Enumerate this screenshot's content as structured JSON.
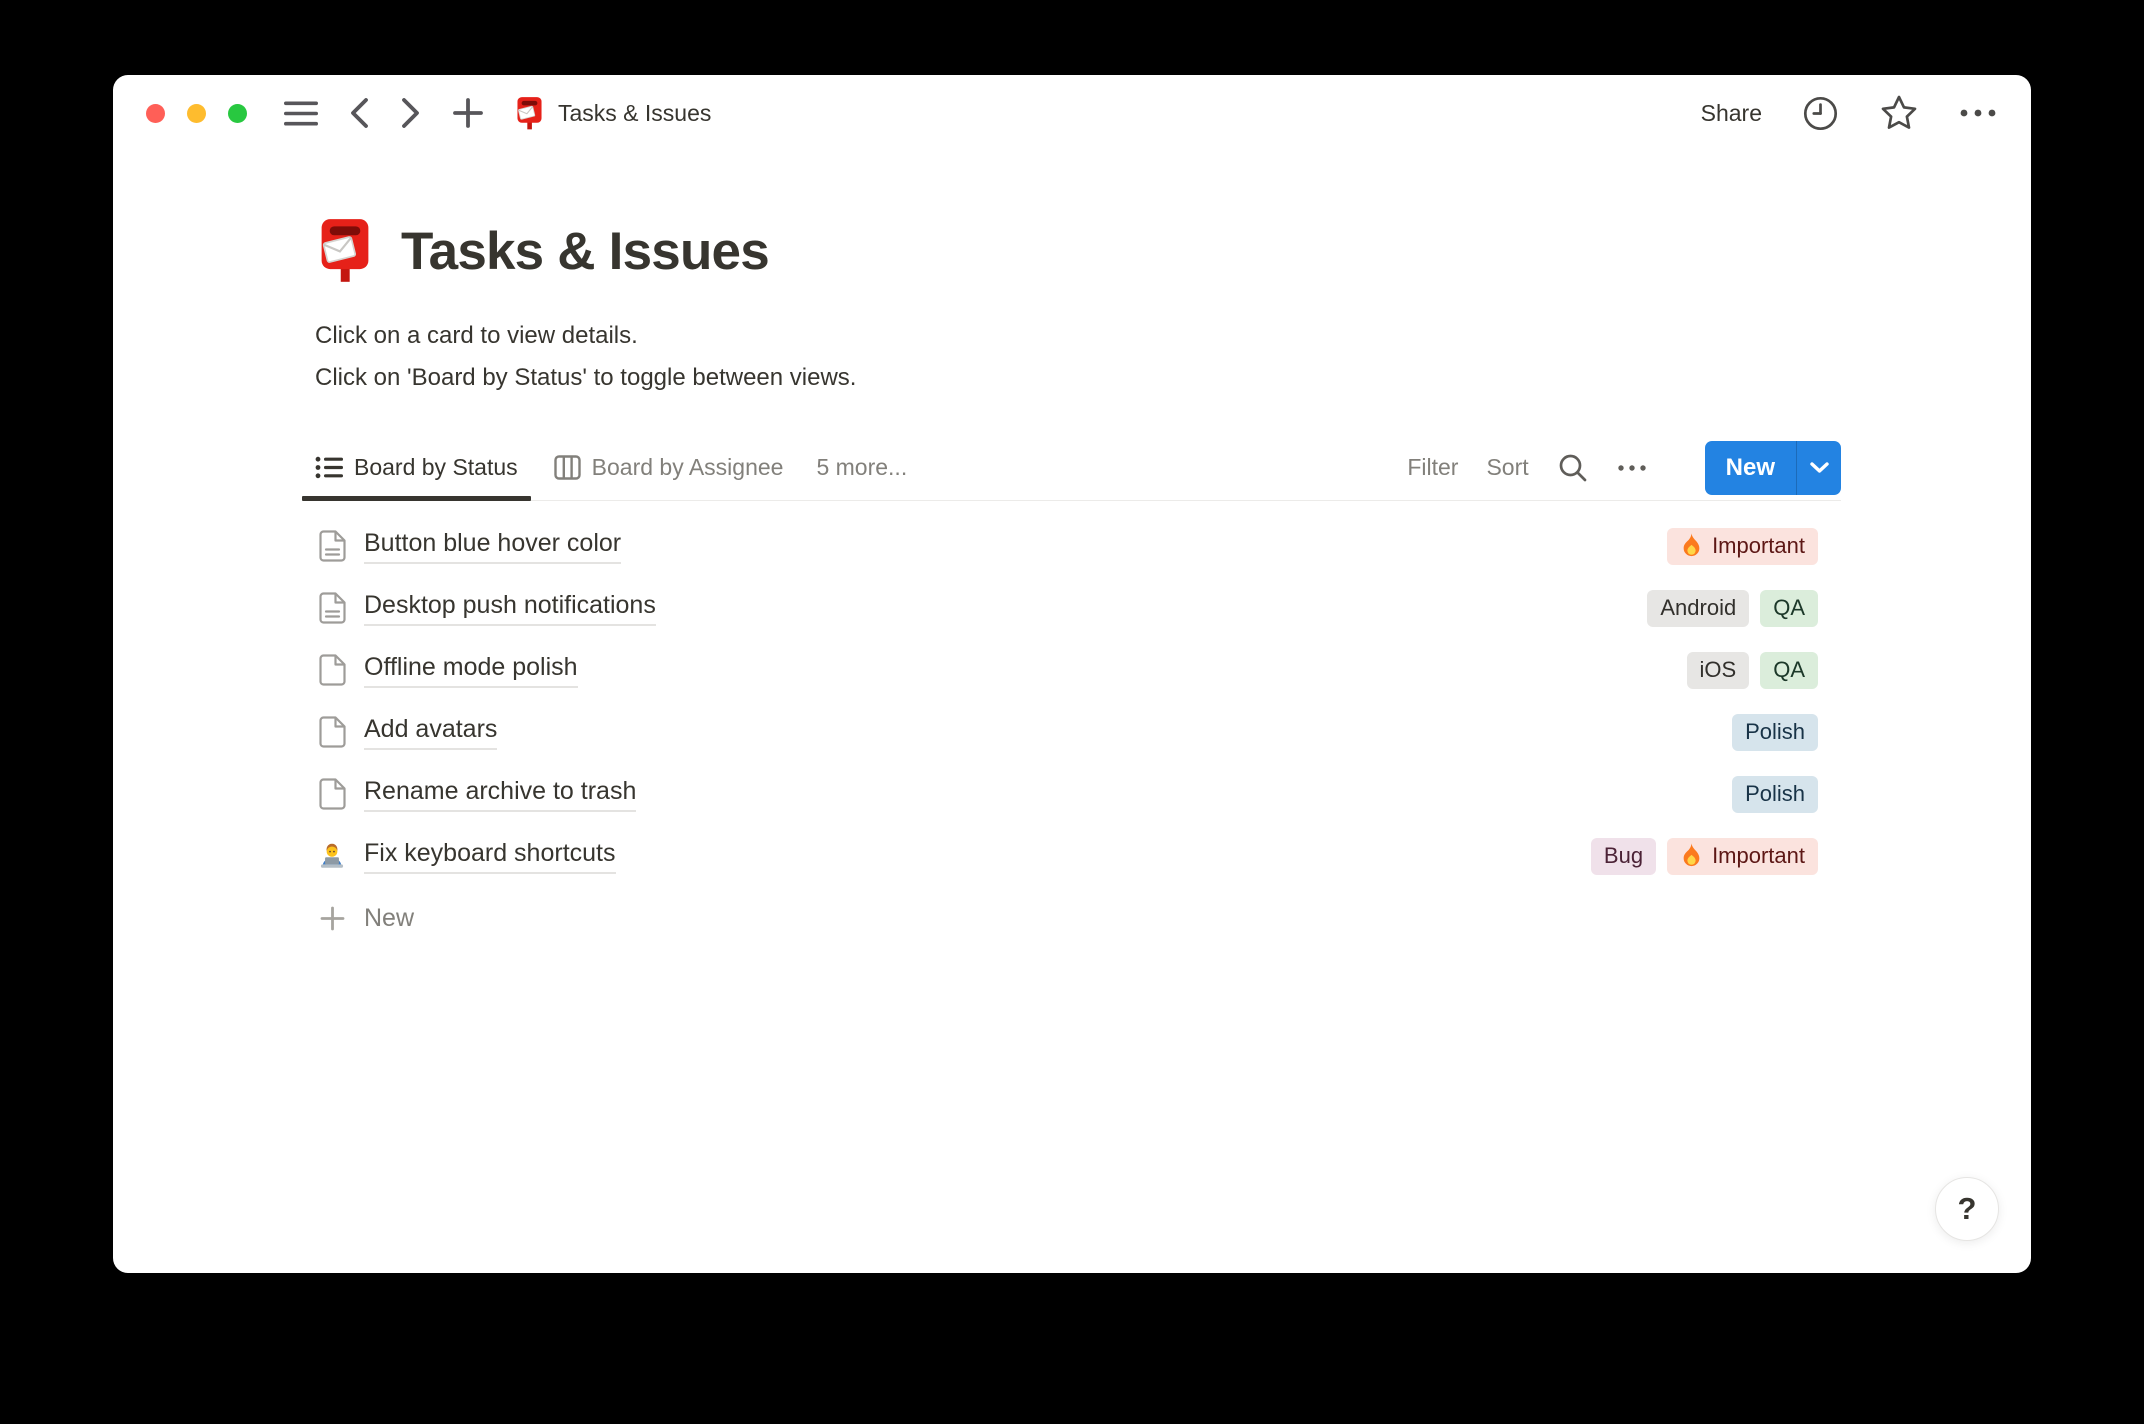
{
  "colors": {
    "desktop_bg": "#000000",
    "window_bg": "#FFFFFF",
    "accent_blue": "#2383E2",
    "text_primary": "#37352F",
    "text_secondary": "#82807B",
    "traffic_red": "#FF5F57",
    "traffic_yellow": "#FEBC2E",
    "traffic_green": "#28C840",
    "active_tab_underline": "#37352F"
  },
  "titlebar": {
    "icons": [
      "hamburger-icon",
      "back-icon",
      "forward-icon",
      "plus-icon",
      "postbox-icon",
      "clock-icon",
      "star-icon",
      "ellipsis-icon"
    ],
    "page_title": "Tasks & Issues",
    "share_label": "Share"
  },
  "page": {
    "icon": "postbox-icon",
    "title": "Tasks & Issues",
    "description_lines": [
      "Click on a card to view details.",
      "Click on 'Board by Status' to toggle between views."
    ]
  },
  "view_bar": {
    "tabs": [
      {
        "label": "Board by Status",
        "icon": "list-view-icon",
        "active": true
      },
      {
        "label": "Board by Assignee",
        "icon": "board-view-icon",
        "active": false
      },
      {
        "label": "5 more...",
        "icon": "",
        "active": false
      }
    ],
    "filter_label": "Filter",
    "sort_label": "Sort",
    "search_icon": "search-icon",
    "more_icon": "ellipsis-icon",
    "new_button": {
      "label": "New",
      "color": "#2383E2",
      "caret_icon": "chevron-down-icon"
    }
  },
  "rows": [
    {
      "icon": "document-text-icon",
      "title": "Button blue hover color",
      "tags": [
        {
          "label": "Important",
          "color": "red",
          "icon": "fire-icon"
        }
      ]
    },
    {
      "icon": "document-text-icon",
      "title": "Desktop push notifications",
      "tags": [
        {
          "label": "Android",
          "color": "gray"
        },
        {
          "label": "QA",
          "color": "green"
        }
      ]
    },
    {
      "icon": "document-blank-icon",
      "title": "Offline mode polish",
      "tags": [
        {
          "label": "iOS",
          "color": "gray"
        },
        {
          "label": "QA",
          "color": "green"
        }
      ]
    },
    {
      "icon": "document-blank-icon",
      "title": "Add avatars",
      "tags": [
        {
          "label": "Polish",
          "color": "blue"
        }
      ]
    },
    {
      "icon": "document-blank-icon",
      "title": "Rename archive to trash",
      "tags": [
        {
          "label": "Polish",
          "color": "blue"
        }
      ]
    },
    {
      "icon": "technologist-icon",
      "title": "Fix keyboard shortcuts",
      "tags": [
        {
          "label": "Bug",
          "color": "pink"
        },
        {
          "label": "Important",
          "color": "red",
          "icon": "fire-icon"
        }
      ]
    }
  ],
  "new_row_label": "New",
  "help_button_label": "?",
  "tag_palette": {
    "red": {
      "bg": "#FBE3DE",
      "text": "#5D1715"
    },
    "gray": {
      "bg": "#E7E6E4",
      "text": "#32302C"
    },
    "green": {
      "bg": "#DBEDDB",
      "text": "#1C3829"
    },
    "blue": {
      "bg": "#D6E4EC",
      "text": "#183347"
    },
    "pink": {
      "bg": "#F0E1EA",
      "text": "#4C2337"
    }
  }
}
